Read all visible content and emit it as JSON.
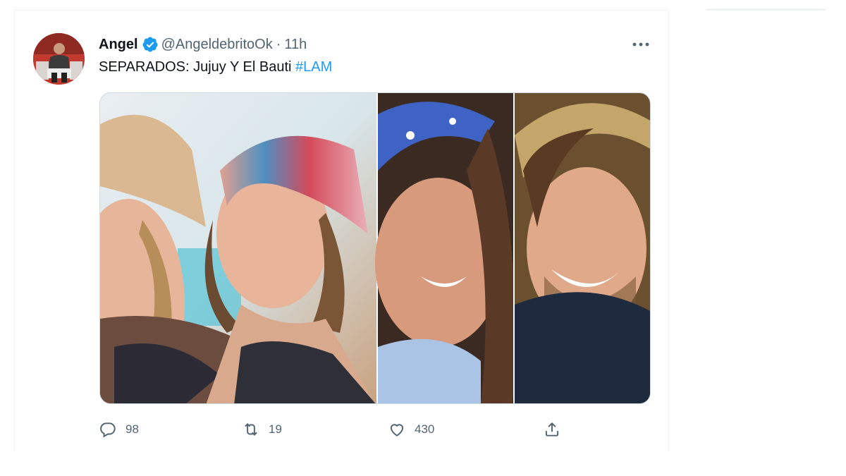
{
  "tweet": {
    "author_name": "Angel",
    "handle": "@AngeldebritoOk",
    "separator": "·",
    "time": "11h",
    "text": "SEPARADOS: Jujuy Y El Bauti",
    "hashtag": "#LAM",
    "verified": true
  },
  "metrics": {
    "replies": "98",
    "retweets": "19",
    "likes": "430"
  },
  "icons": {
    "verified": "verified-badge-icon",
    "more": "more-dots-icon",
    "reply": "reply-icon",
    "retweet": "retweet-icon",
    "like": "heart-icon",
    "share": "share-icon"
  },
  "colors": {
    "accent": "#1d9bf0",
    "text": "#0f1419",
    "secondary": "#536471",
    "border": "#eff3f4"
  }
}
